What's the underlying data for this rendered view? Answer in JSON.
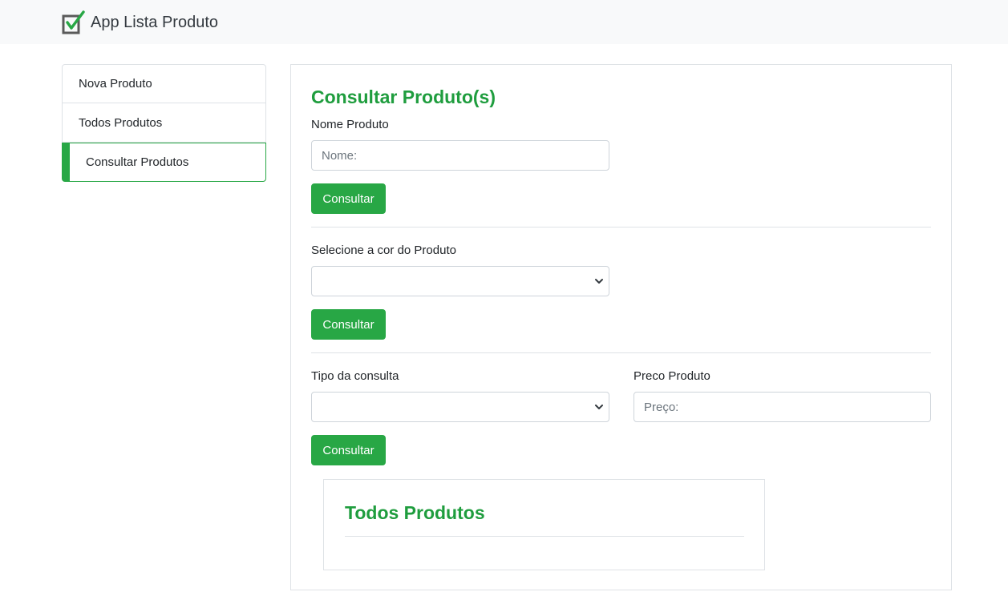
{
  "app": {
    "title": "App Lista Produto",
    "logo_icon": "checkbox-check-icon",
    "accent_color": "#28a745"
  },
  "sidebar": {
    "items": [
      {
        "label": "Nova Produto",
        "active": false
      },
      {
        "label": "Todos Produtos",
        "active": false
      },
      {
        "label": "Consultar Produtos",
        "active": true
      }
    ]
  },
  "main": {
    "title": "Consultar Produto(s)",
    "name_section": {
      "label": "Nome Produto",
      "placeholder": "Nome:",
      "value": "",
      "button": "Consultar"
    },
    "color_section": {
      "label": "Selecione a cor do Produto",
      "selected": "",
      "button": "Consultar"
    },
    "price_section": {
      "type_label": "Tipo da consulta",
      "type_selected": "",
      "price_label": "Preco Produto",
      "price_placeholder": "Preço:",
      "price_value": "",
      "button": "Consultar"
    },
    "results": {
      "title": "Todos Produtos"
    }
  }
}
